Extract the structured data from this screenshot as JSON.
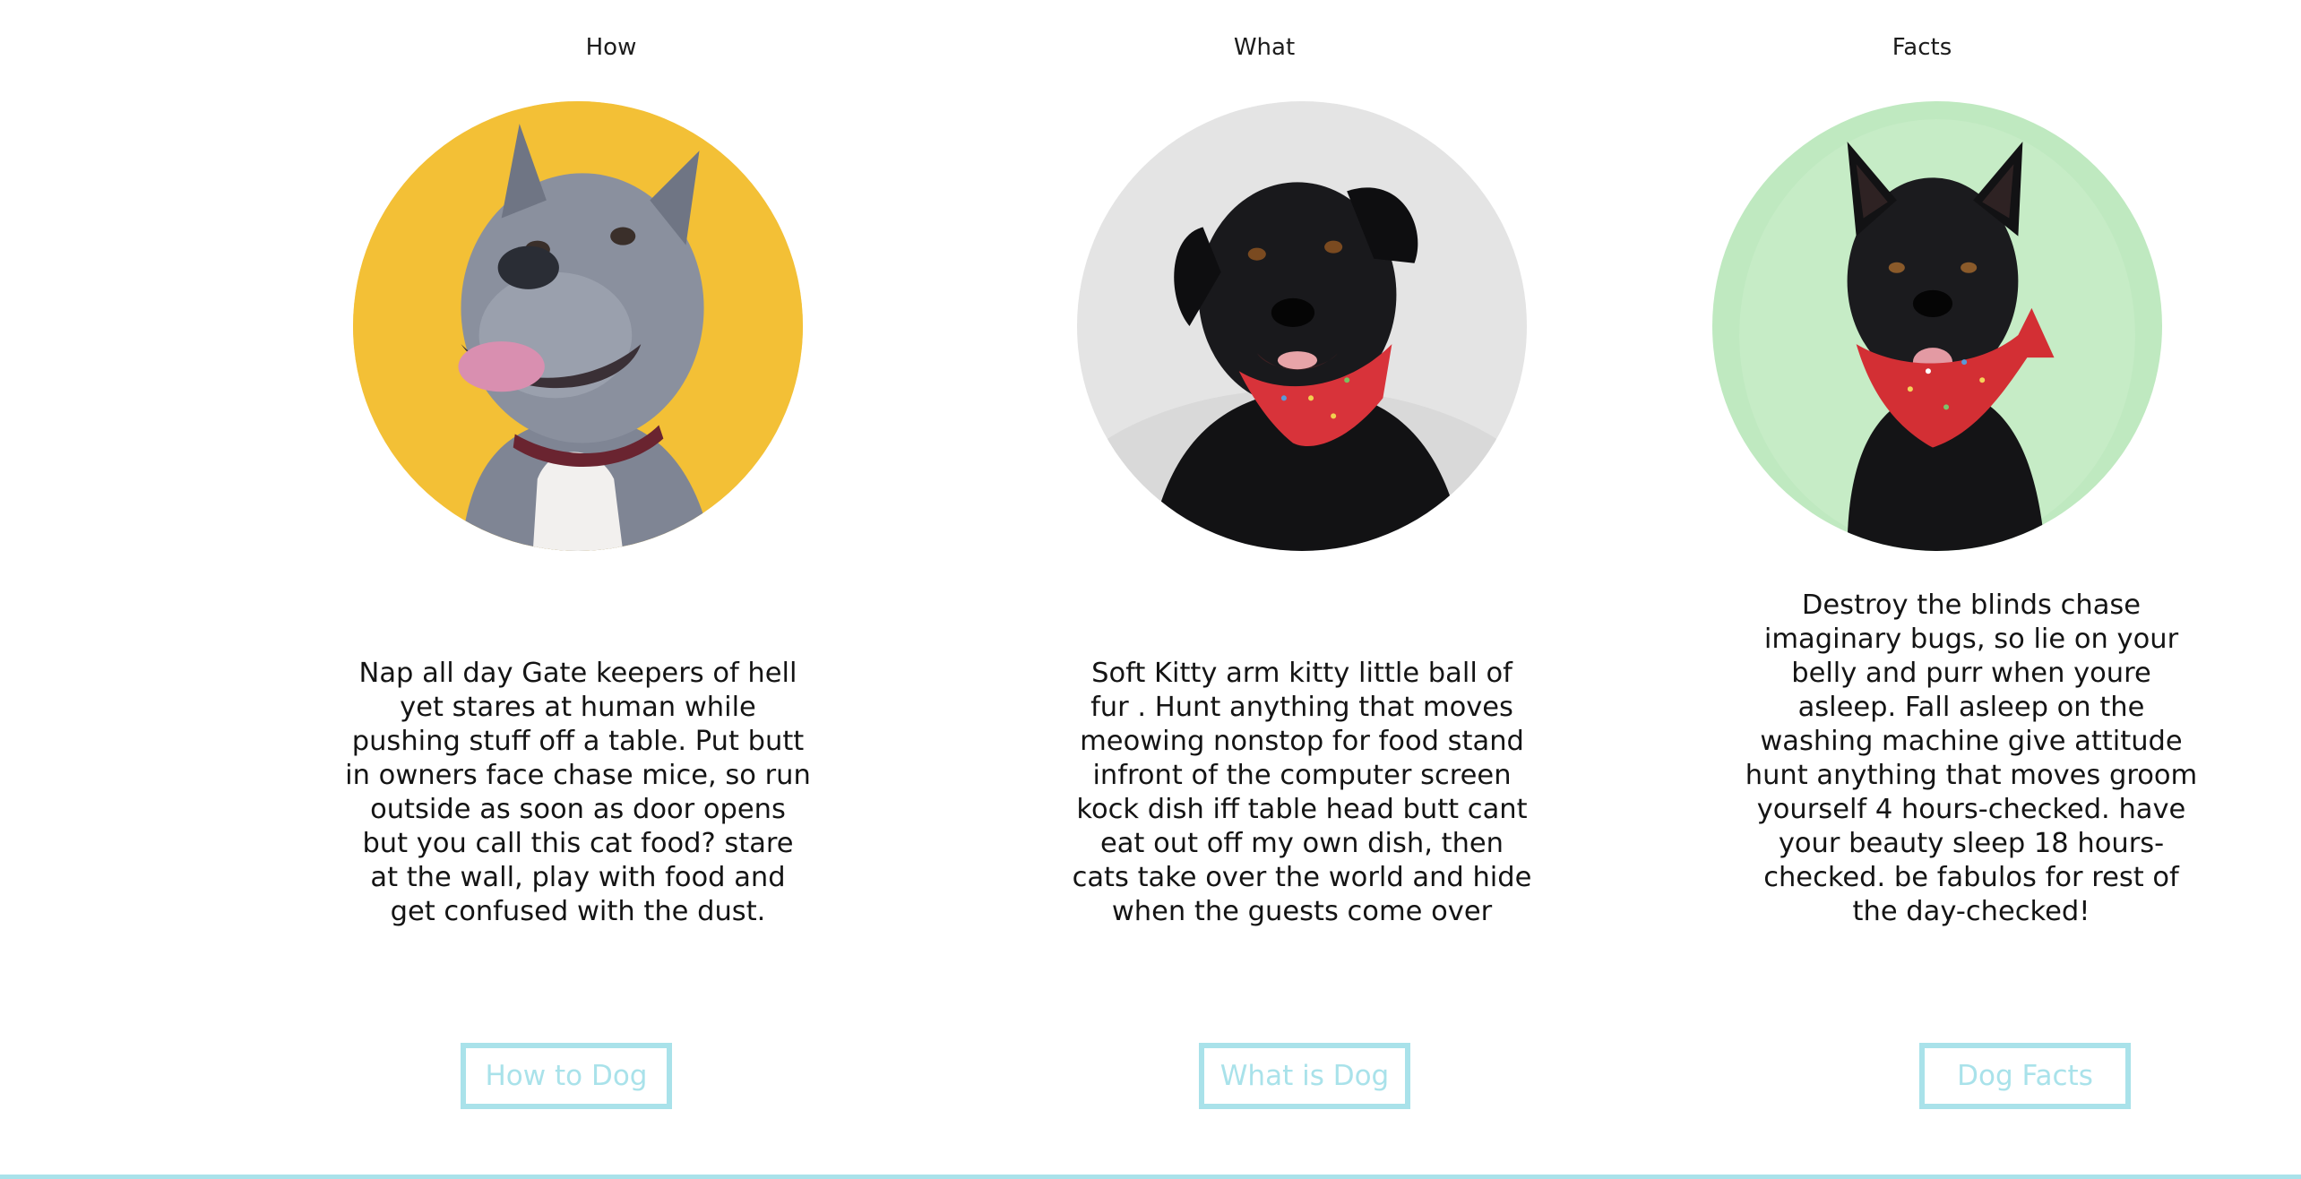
{
  "columns": [
    {
      "title": "How",
      "text": "Nap all day Gate keepers of hell yet stares at human while pushing stuff off a table. Put butt in owners face chase mice, so run outside as soon as door opens but you call this cat food? stare at the wall, play with food and get confused with the dust.",
      "button_label": "How to Dog",
      "photo_background": "#f2bd30"
    },
    {
      "title": "What",
      "text": "Soft Kitty arm kitty little ball of fur . Hunt anything that moves meowing nonstop for food stand infront of the computer screen kock dish iff table head butt cant eat out off my own dish, then cats take over the world and hide when the guests come over",
      "button_label": "What is Dog",
      "photo_background": "#e4e4e4"
    },
    {
      "title": "Facts",
      "text": "Destroy the blinds chase imaginary bugs, so lie on your belly and purr when youre asleep. Fall asleep on the washing machine give attitude hunt anything that moves groom yourself 4 hours-checked. have your beauty sleep 18 hours-checked. be fabulos for rest of the day-checked!",
      "button_label": "Dog Facts",
      "photo_background": "#bfe9c0"
    }
  ],
  "colors": {
    "accent": "#a9e2ea",
    "text": "#141414",
    "background": "#ffffff"
  }
}
